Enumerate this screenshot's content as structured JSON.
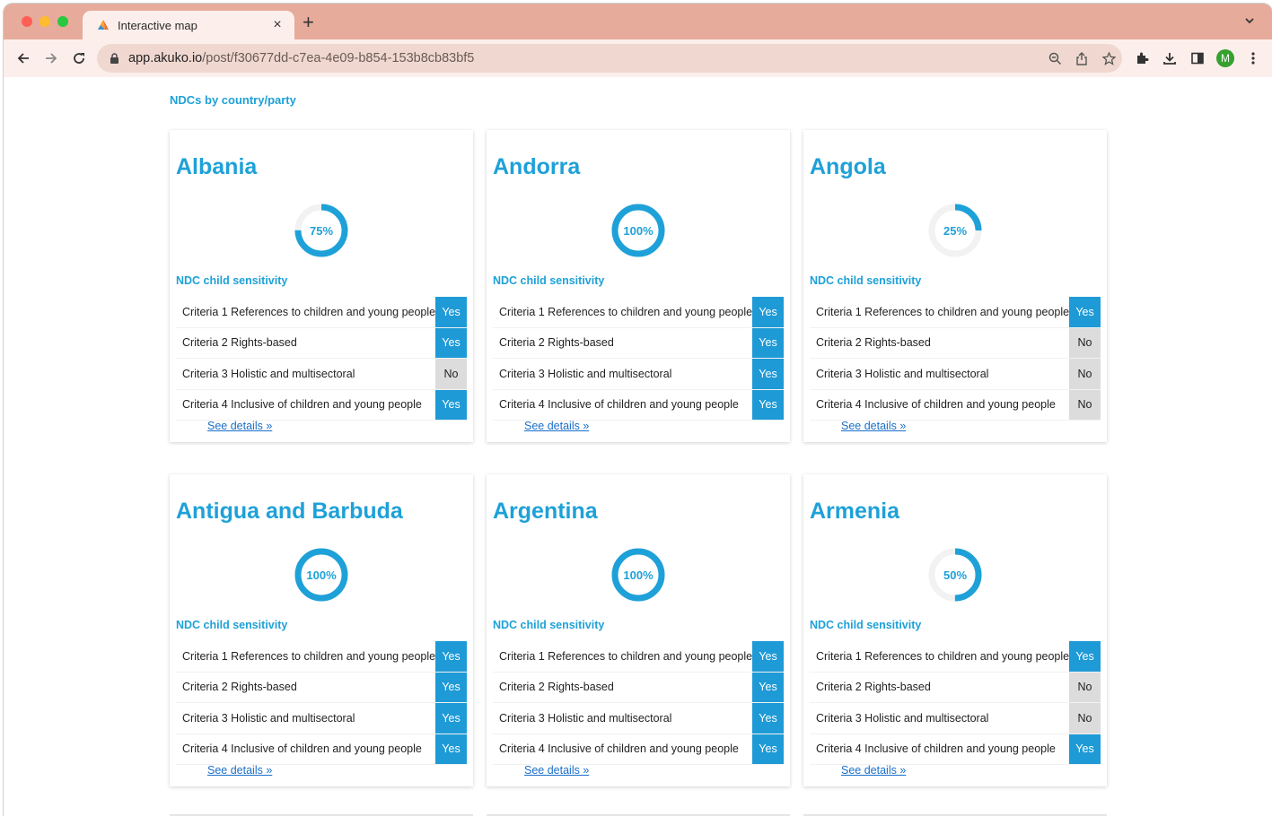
{
  "browser": {
    "tab_title": "Interactive map",
    "tab_close": "×",
    "new_tab": "+",
    "url_host": "app.akuko.io",
    "url_path": "/post/f30677dd-c7ea-4e09-b854-153b8cb83bf5",
    "avatar_letter": "M"
  },
  "page": {
    "header_link": "NDCs by country/party",
    "section_title": "NDC child sensitivity",
    "details_label": "See details »"
  },
  "cards": [
    {
      "country": "Albania",
      "percent": 75,
      "percent_label": "75%",
      "criteria": [
        {
          "label": "Criteria 1 References to children and young people",
          "value": "Yes"
        },
        {
          "label": "Criteria 2 Rights-based",
          "value": "Yes"
        },
        {
          "label": "Criteria 3 Holistic and multisectoral",
          "value": "No"
        },
        {
          "label": "Criteria 4 Inclusive of children and young people",
          "value": "Yes"
        }
      ]
    },
    {
      "country": "Andorra",
      "percent": 100,
      "percent_label": "100%",
      "criteria": [
        {
          "label": "Criteria 1 References to children and young people",
          "value": "Yes"
        },
        {
          "label": "Criteria 2 Rights-based",
          "value": "Yes"
        },
        {
          "label": "Criteria 3 Holistic and multisectoral",
          "value": "Yes"
        },
        {
          "label": "Criteria 4 Inclusive of children and young people",
          "value": "Yes"
        }
      ]
    },
    {
      "country": "Angola",
      "percent": 25,
      "percent_label": "25%",
      "criteria": [
        {
          "label": "Criteria 1 References to children and young people",
          "value": "Yes"
        },
        {
          "label": "Criteria 2 Rights-based",
          "value": "No"
        },
        {
          "label": "Criteria 3 Holistic and multisectoral",
          "value": "No"
        },
        {
          "label": "Criteria 4 Inclusive of children and young people",
          "value": "No"
        }
      ]
    },
    {
      "country": "Antigua and Barbuda",
      "percent": 100,
      "percent_label": "100%",
      "criteria": [
        {
          "label": "Criteria 1 References to children and young people",
          "value": "Yes"
        },
        {
          "label": "Criteria 2 Rights-based",
          "value": "Yes"
        },
        {
          "label": "Criteria 3 Holistic and multisectoral",
          "value": "Yes"
        },
        {
          "label": "Criteria 4 Inclusive of children and young people",
          "value": "Yes"
        }
      ]
    },
    {
      "country": "Argentina",
      "percent": 100,
      "percent_label": "100%",
      "criteria": [
        {
          "label": "Criteria 1 References to children and young people",
          "value": "Yes"
        },
        {
          "label": "Criteria 2 Rights-based",
          "value": "Yes"
        },
        {
          "label": "Criteria 3 Holistic and multisectoral",
          "value": "Yes"
        },
        {
          "label": "Criteria 4 Inclusive of children and young people",
          "value": "Yes"
        }
      ]
    },
    {
      "country": "Armenia",
      "percent": 50,
      "percent_label": "50%",
      "criteria": [
        {
          "label": "Criteria 1 References to children and young people",
          "value": "Yes"
        },
        {
          "label": "Criteria 2 Rights-based",
          "value": "No"
        },
        {
          "label": "Criteria 3 Holistic and multisectoral",
          "value": "No"
        },
        {
          "label": "Criteria 4 Inclusive of children and young people",
          "value": "Yes"
        }
      ]
    }
  ],
  "colors": {
    "accent": "#1ea1d8",
    "yes_badge": "#1e9ad6",
    "no_badge": "#dcdcdc",
    "donut_track": "#f2f2f2",
    "link": "#1a6fc9",
    "tabstrip": "#e6ab9b"
  },
  "icons": [
    "akuko-favicon",
    "back-arrow-icon",
    "forward-arrow-icon",
    "reload-icon",
    "lock-icon",
    "zoom-icon",
    "share-icon",
    "star-icon",
    "extensions-icon",
    "download-icon",
    "sidepanel-icon",
    "menu-dots-icon",
    "chevron-down-icon"
  ]
}
